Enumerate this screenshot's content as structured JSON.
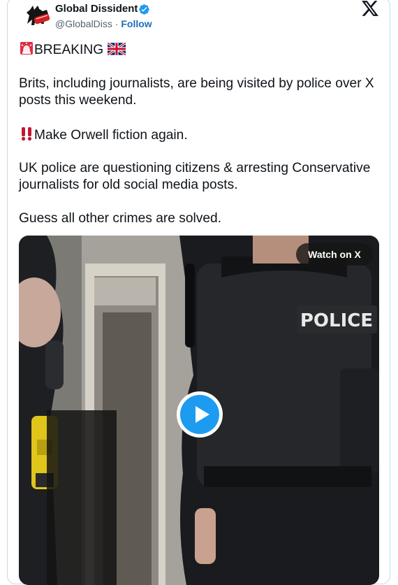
{
  "author": {
    "name": "Global Dissident",
    "handle": "@GlobalDiss",
    "separator": " · ",
    "follow_label": "Follow",
    "verified_color": "#1d9bf0"
  },
  "post": {
    "breaking": "BREAKING",
    "line1": "Brits, including journalists, are being visited by police over X posts this weekend.",
    "line2": "Make Orwell fiction again.",
    "line3": "UK police are questioning citizens & arresting Conservative journalists for old social media posts.",
    "line4": "Guess all other crimes are solved."
  },
  "media": {
    "watch_label": "Watch on X",
    "vest_text": "POLICE",
    "accent_color": "#1d9bf0"
  },
  "icons": {
    "siren": "police-siren-icon",
    "flag": "uk-flag-icon",
    "exclamation": "double-exclamation-icon",
    "x_logo": "x-logo-icon",
    "play": "play-icon"
  }
}
